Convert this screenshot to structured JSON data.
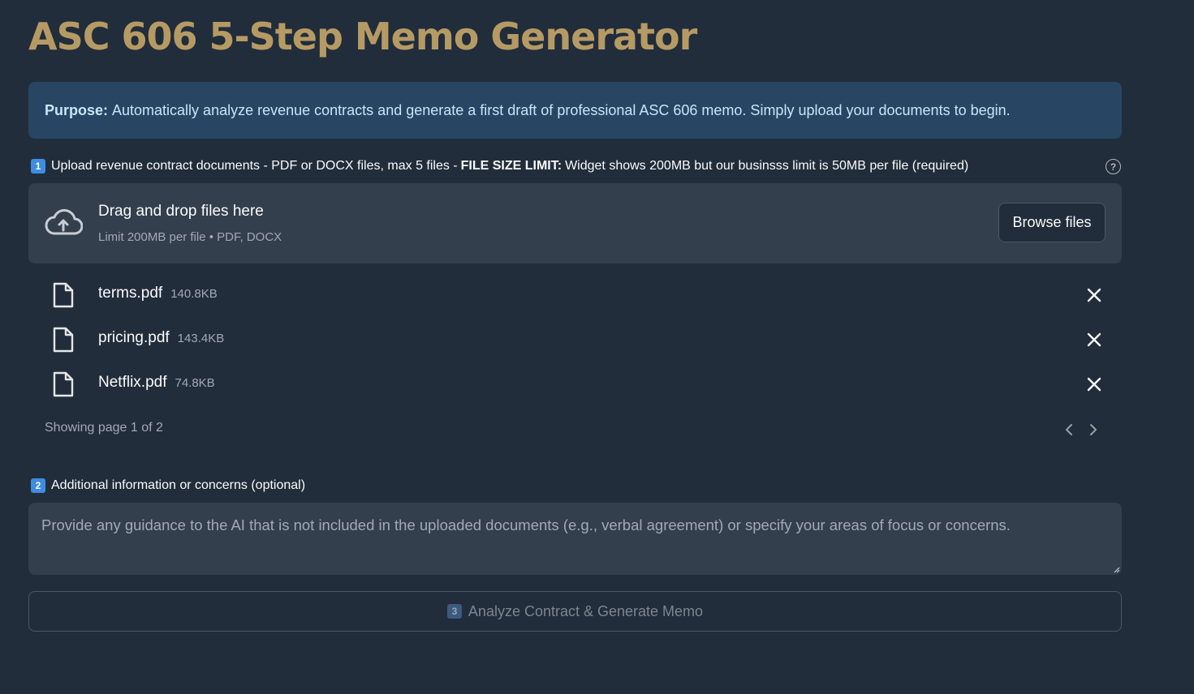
{
  "page": {
    "title": "ASC 606 5-Step Memo Generator"
  },
  "info": {
    "bold_label": "Purpose:",
    "text": "Automatically analyze revenue contracts and generate a first draft of professional ASC 606 memo. Simply upload your documents to begin."
  },
  "upload": {
    "badge": "1",
    "label_prefix": "Upload revenue contract documents - PDF or DOCX files, max 5 files -",
    "label_bold": "FILE SIZE LIMIT:",
    "label_suffix": "Widget shows 200MB but our businsss limit is 50MB per file (required)",
    "help_icon": "?",
    "dropzone_title": "Drag and drop files here",
    "dropzone_subtitle": "Limit 200MB per file • PDF, DOCX",
    "browse_label": "Browse files",
    "files": [
      {
        "name": "terms.pdf",
        "size": "140.8KB"
      },
      {
        "name": "pricing.pdf",
        "size": "143.4KB"
      },
      {
        "name": "Netflix.pdf",
        "size": "74.8KB"
      }
    ],
    "pager_text": "Showing page 1 of 2"
  },
  "additional": {
    "badge": "2",
    "label": "Additional information or concerns (optional)",
    "placeholder": "Provide any guidance to the AI that is not included in the uploaded documents (e.g., verbal agreement) or specify your areas of focus or concerns."
  },
  "analyze": {
    "badge": "3",
    "label": "Analyze Contract & Generate Memo"
  },
  "colors": {
    "background": "#212d3b",
    "title": "#b69a64",
    "info_bg": "#284663",
    "info_text": "#c7e5f8",
    "panel": "#333f4d",
    "badge_blue": "#3e8de0"
  },
  "icons": [
    "cloud-upload-icon",
    "file-icon",
    "close-icon",
    "help-icon",
    "chevron-left-icon",
    "chevron-right-icon"
  ]
}
